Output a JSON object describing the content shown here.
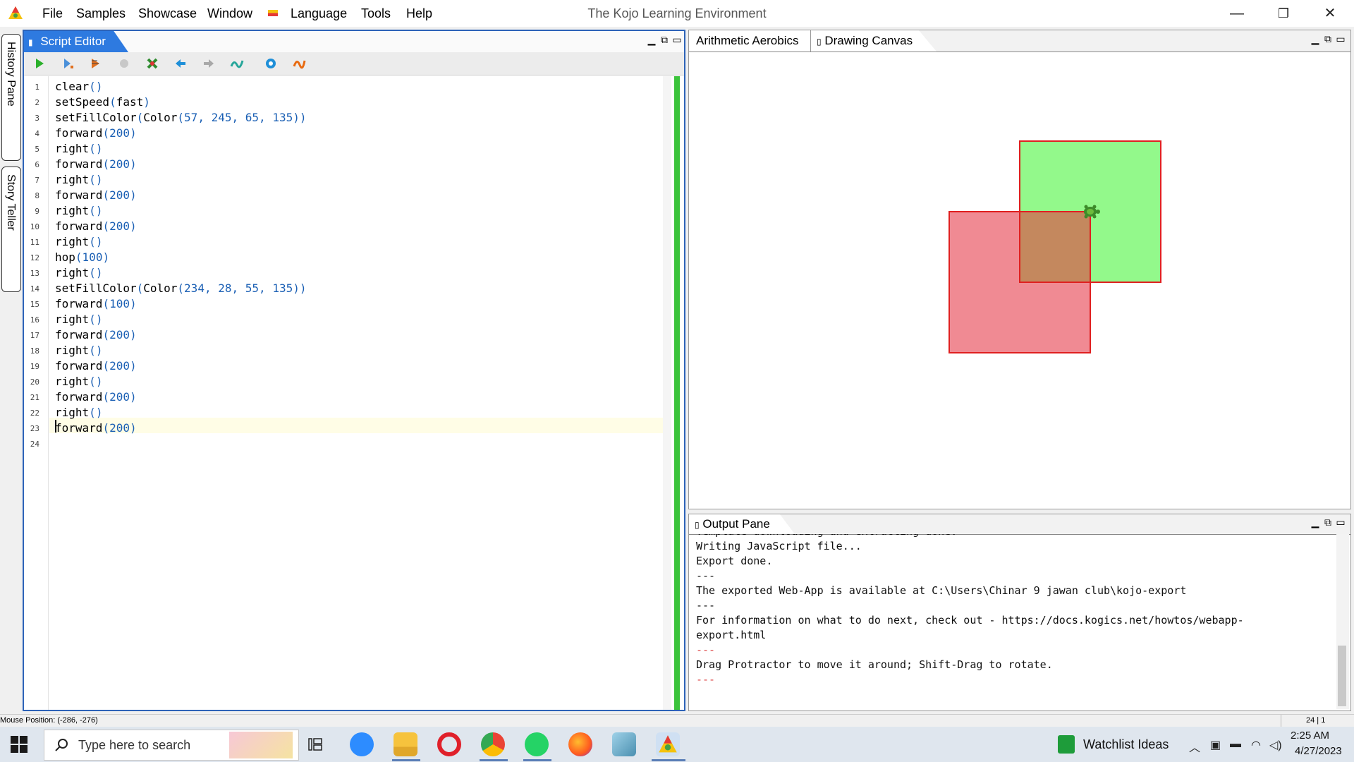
{
  "window": {
    "title": "The Kojo Learning Environment",
    "controls": {
      "minimize": "—",
      "maximize": "❐",
      "close": "✕"
    }
  },
  "menu": {
    "items": [
      "File",
      "Samples",
      "Showcase",
      "Window",
      "Language",
      "Tools",
      "Help"
    ]
  },
  "side_tabs": {
    "history": "History Pane",
    "story": "Story Teller"
  },
  "editor": {
    "tab_label": "Script Editor",
    "toolbar_icons": [
      "run-icon",
      "run-worksheet-icon",
      "trace-icon",
      "stop-icon",
      "clear-icon",
      "undo-icon",
      "redo-icon",
      "format-icon",
      "help-icon",
      "history-icon"
    ],
    "lines": [
      {
        "n": "1",
        "code": "clear()"
      },
      {
        "n": "2",
        "code": "setSpeed(fast)"
      },
      {
        "n": "3",
        "code": "setFillColor(Color(57, 245, 65, 135))"
      },
      {
        "n": "4",
        "code": "forward(200)"
      },
      {
        "n": "5",
        "code": "right()"
      },
      {
        "n": "6",
        "code": "forward(200)"
      },
      {
        "n": "7",
        "code": "right()"
      },
      {
        "n": "8",
        "code": "forward(200)"
      },
      {
        "n": "9",
        "code": "right()"
      },
      {
        "n": "10",
        "code": "forward(200)"
      },
      {
        "n": "11",
        "code": "right()"
      },
      {
        "n": "12",
        "code": "hop(100)"
      },
      {
        "n": "13",
        "code": "right()"
      },
      {
        "n": "14",
        "code": "setFillColor(Color(234, 28, 55, 135))"
      },
      {
        "n": "15",
        "code": "forward(100)"
      },
      {
        "n": "16",
        "code": "right()"
      },
      {
        "n": "17",
        "code": "forward(200)"
      },
      {
        "n": "18",
        "code": "right()"
      },
      {
        "n": "19",
        "code": "forward(200)"
      },
      {
        "n": "20",
        "code": "right()"
      },
      {
        "n": "21",
        "code": "forward(200)"
      },
      {
        "n": "22",
        "code": "right()"
      },
      {
        "n": "23",
        "code": "forward(200)"
      },
      {
        "n": "24",
        "code": ""
      }
    ]
  },
  "canvas": {
    "tabs": [
      "Arithmetic Aerobics",
      "Drawing Canvas"
    ],
    "active_tab": "Drawing Canvas",
    "shapes": [
      {
        "name": "green-square",
        "fill": "#93f98b",
        "stroke": "#e02020"
      },
      {
        "name": "red-square",
        "fill": "#f08a93",
        "stroke": "#e02020"
      }
    ],
    "overlap_fill": "#c4885e"
  },
  "output": {
    "tab_label": "Output Pane",
    "lines": [
      {
        "text": "Template downloading and extracting done.",
        "dash": false
      },
      {
        "text": "Writing JavaScript file...",
        "dash": false
      },
      {
        "text": "Export done.",
        "dash": false
      },
      {
        "text": "---",
        "dash": false
      },
      {
        "text": "The exported Web-App is available at C:\\Users\\Chinar 9 jawan club\\kojo-export",
        "dash": false
      },
      {
        "text": "---",
        "dash": false
      },
      {
        "text": "For information on what to do next, check out - https://docs.kogics.net/howtos/webapp-",
        "dash": false
      },
      {
        "text": "export.html",
        "dash": false
      },
      {
        "text": "---",
        "dash": true
      },
      {
        "text": "Drag Protractor to move it around; Shift-Drag to rotate.",
        "dash": false
      },
      {
        "text": "---",
        "dash": true
      }
    ]
  },
  "status": {
    "mouse_position": "Mouse Position: (-286, -276)",
    "caret_position": "24 | 1"
  },
  "taskbar": {
    "search_placeholder": "Type here to search",
    "apps": [
      "task-view-icon",
      "zoom-icon",
      "file-explorer-icon",
      "opera-icon",
      "chrome-icon",
      "whatsapp-icon",
      "firefox-icon",
      "notepad-icon",
      "kojo-icon"
    ],
    "widget_text": "Watchlist Ideas",
    "time": "2:25 AM",
    "date": "4/27/2023"
  }
}
